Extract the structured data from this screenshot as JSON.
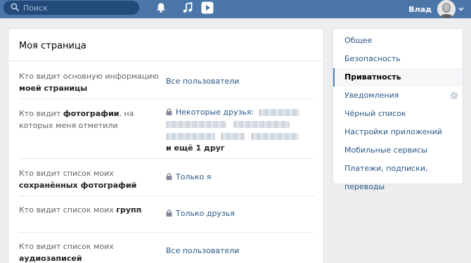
{
  "topbar": {
    "search_placeholder": "Поиск",
    "user_name": "Влад",
    "bg_color": "#4a76a8",
    "icons": [
      "search-icon",
      "bell-icon",
      "music-icon",
      "video-play-icon",
      "avatar",
      "chevron-down-icon"
    ]
  },
  "main": {
    "title": "Моя страница",
    "rows": [
      {
        "label_pre": "Кто видит основную информацию ",
        "label_bold": "моей страницы",
        "value": "Все пользователи",
        "locked": false
      },
      {
        "label_pre": "Кто видит ",
        "label_bold": "фотографии",
        "label_post": ", на которых меня отметили",
        "value": "Некоторые друзья:",
        "more": "и ещё 1 друг",
        "locked": true
      },
      {
        "label_pre": "Кто видит список моих ",
        "label_bold": "сохранённых фотографий",
        "value": "Только я",
        "locked": true
      },
      {
        "label_pre": "Кто видит список моих ",
        "label_bold": "групп",
        "value": "Только друзья",
        "locked": true
      },
      {
        "label_pre": "Кто видит список моих ",
        "label_bold": "аудиозаписей",
        "value": "Все пользователи",
        "locked": false
      }
    ]
  },
  "menu": {
    "items": [
      {
        "label": "Общее",
        "active": false
      },
      {
        "label": "Безопасность",
        "active": false
      },
      {
        "label": "Приватность",
        "active": true
      },
      {
        "label": "Уведомления",
        "active": false,
        "icon": "gear-icon"
      },
      {
        "label": "Чёрный список",
        "active": false
      },
      {
        "label": "Настройки приложений",
        "active": false
      },
      {
        "label": "Мобильные сервисы",
        "active": false
      },
      {
        "label": "Платежи, подписки, переводы",
        "active": false
      }
    ],
    "accent_color": "#5181b8",
    "link_color": "#2a5885"
  }
}
